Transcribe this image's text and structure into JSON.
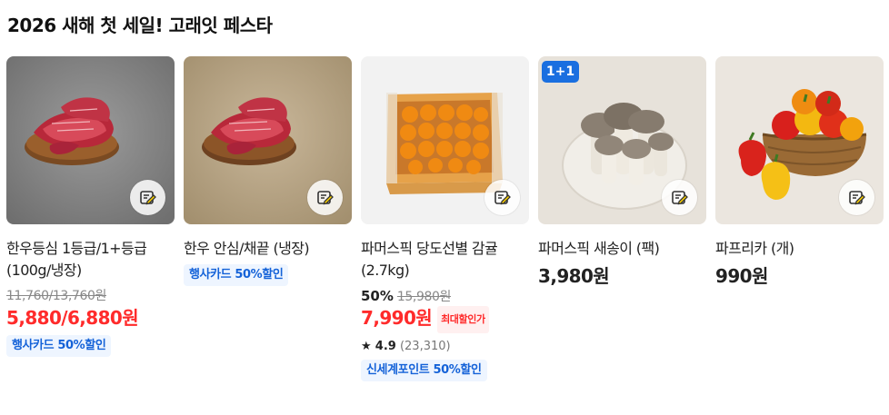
{
  "section": {
    "title": "2026 새해 첫 세일! 고래잇 페스타"
  },
  "products": [
    {
      "name": "한우등심 1등급/1+등급(100g/냉장)",
      "original_price": "11,760/13,760원",
      "price": "5,880/6,880원",
      "chip": "행사카드 50%할인",
      "thumb_icon": "beef-image"
    },
    {
      "name": "한우 안심/채끝 (냉장)",
      "chip": "행사카드 50%할인",
      "thumb_icon": "beef-image"
    },
    {
      "name": "파머스픽 당도선별 감귤(2.7kg)",
      "discount": "50%",
      "original_price": "15,980원",
      "price": "7,990원",
      "price_tag": "최대할인가",
      "rating": "4.9",
      "review_count": "(23,310)",
      "chip": "신세계포인트 50%할인",
      "thumb_icon": "tangerine-box-image"
    },
    {
      "name": "파머스픽 새송이 (팩)",
      "price": "3,980원",
      "badge": "1+1",
      "thumb_icon": "mushroom-image"
    },
    {
      "name": "파프리카 (개)",
      "price": "990원",
      "thumb_icon": "paprika-image"
    }
  ],
  "colors": {
    "sale_red": "#ff2b2b",
    "badge_blue": "#1a6fe0",
    "chip_bg": "#eef5ff",
    "chip_text": "#1462d8"
  },
  "icons": {
    "memo": "memo-pencil-icon",
    "star": "star-icon"
  }
}
